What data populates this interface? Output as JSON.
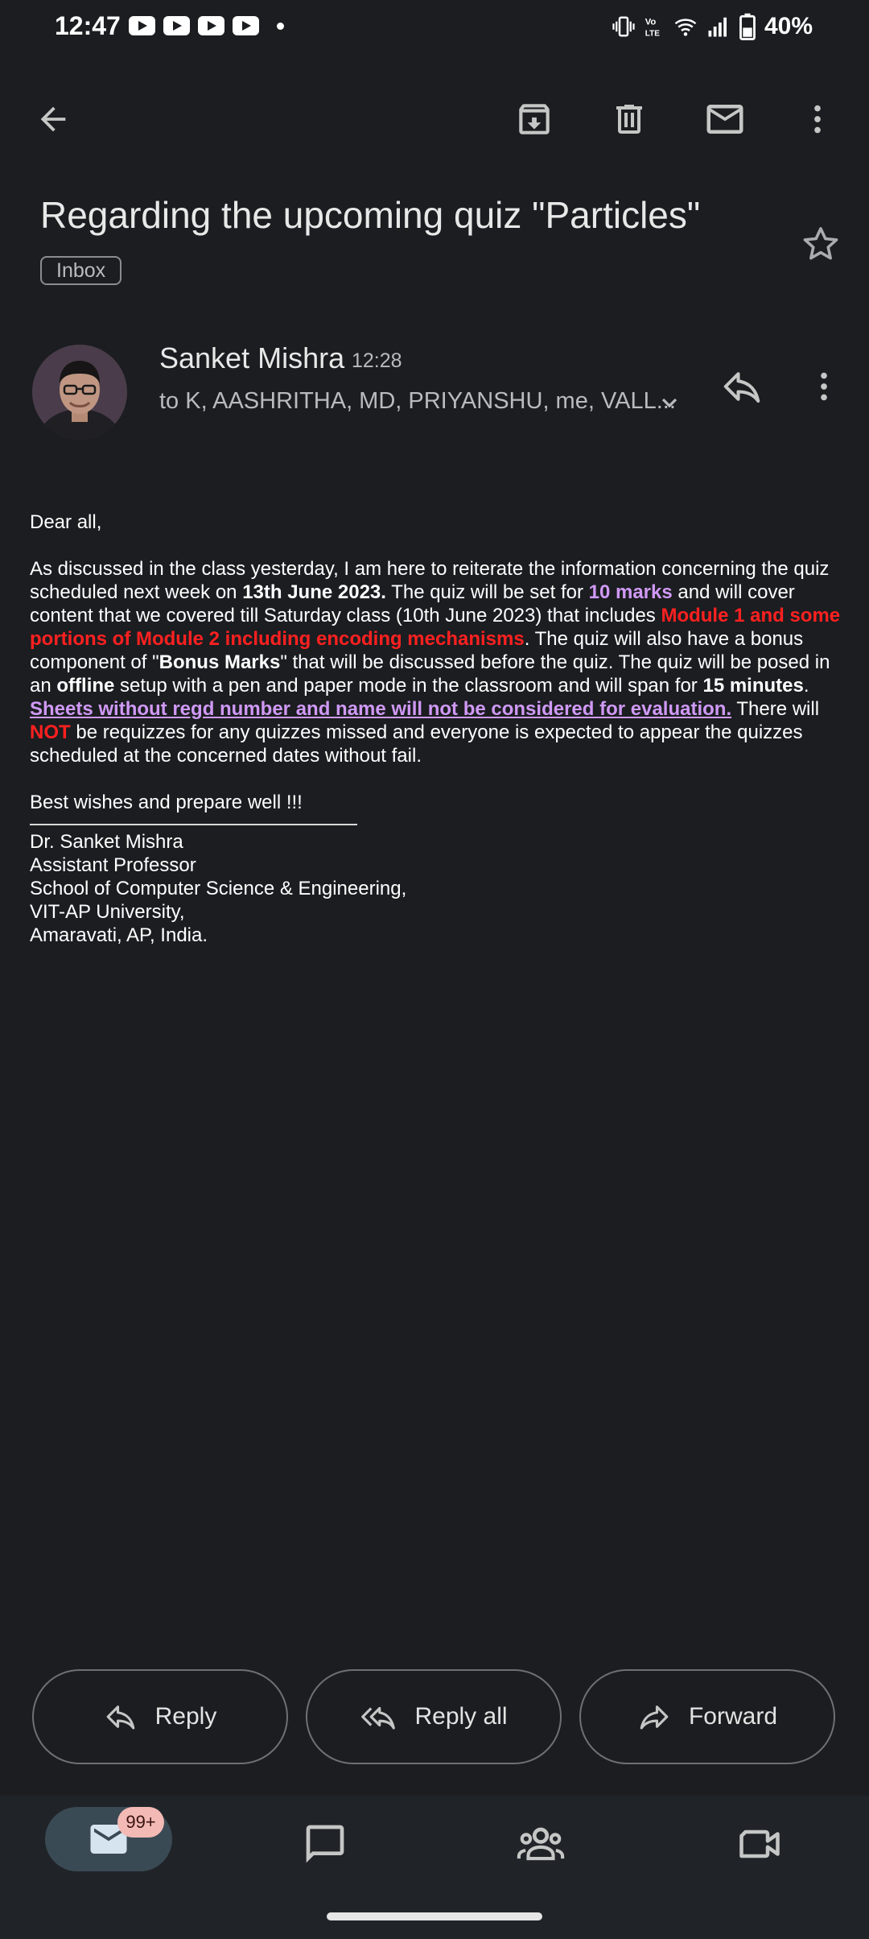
{
  "status_bar": {
    "time": "12:47",
    "battery": "40%",
    "notification_icons": [
      "youtube-icon",
      "youtube-icon",
      "youtube-icon",
      "youtube-icon",
      "dot-icon"
    ],
    "system_icons": [
      "vibrate-icon",
      "volte-icon",
      "wifi-icon",
      "signal-icon",
      "battery-icon"
    ]
  },
  "toolbar": {
    "icons": [
      "back-arrow-icon",
      "archive-icon",
      "delete-icon",
      "mark-unread-icon",
      "more-vert-icon"
    ]
  },
  "email": {
    "subject": "Regarding the upcoming quiz \"Particles\"",
    "label": "Inbox",
    "sender": "Sanket Mishra",
    "time": "12:28",
    "recipients": "to K, AASHRITHA, MD, PRIYANSHU, me, VALL...",
    "greeting": "Dear all,",
    "para": {
      "t1": "As discussed in the class yesterday, I am here to reiterate the information concerning the quiz scheduled next week on ",
      "date": "13th June 2023.",
      "t2": " The quiz will be set for ",
      "marks": "10 marks",
      "t3": " and will cover content that we covered till Saturday class (10th June 2023) that includes ",
      "modules": "Module 1 and some portions of Module 2 including encoding mechanisms",
      "t4": ". The quiz will also have a bonus component of \"",
      "bonus": "Bonus Marks",
      "t5": "\" that will be discussed before the quiz. The quiz will be posed in an ",
      "offline": "offline",
      "t6": " setup with a pen and paper mode in the classroom and will span for ",
      "duration": "15 minutes",
      "t7": ".",
      "warning": "Sheets without regd number and name will not be considered for evaluation.",
      "t8": " There will ",
      "not": "NOT",
      "t9": " be requizzes for any quizzes missed and everyone is expected to appear the quizzes scheduled at the concerned dates without fail."
    },
    "closing": "Best wishes and prepare well !!!",
    "signature": [
      "Dr. Sanket Mishra",
      "Assistant Professor",
      "School of Computer Science & Engineering,",
      "VIT-AP University,",
      "Amaravati, AP, India."
    ]
  },
  "actions": {
    "reply": "Reply",
    "reply_all": "Reply all",
    "forward": "Forward"
  },
  "bottom_nav": {
    "mail_badge": "99+",
    "items": [
      "mail-icon",
      "chat-icon",
      "spaces-icon",
      "meet-icon"
    ]
  },
  "colors": {
    "background": "#1b1d20",
    "accent_purple": "#d099f6",
    "alert_red": "#ff2020",
    "nav_pill": "#3a4a55",
    "badge": "#f3b9b5"
  }
}
